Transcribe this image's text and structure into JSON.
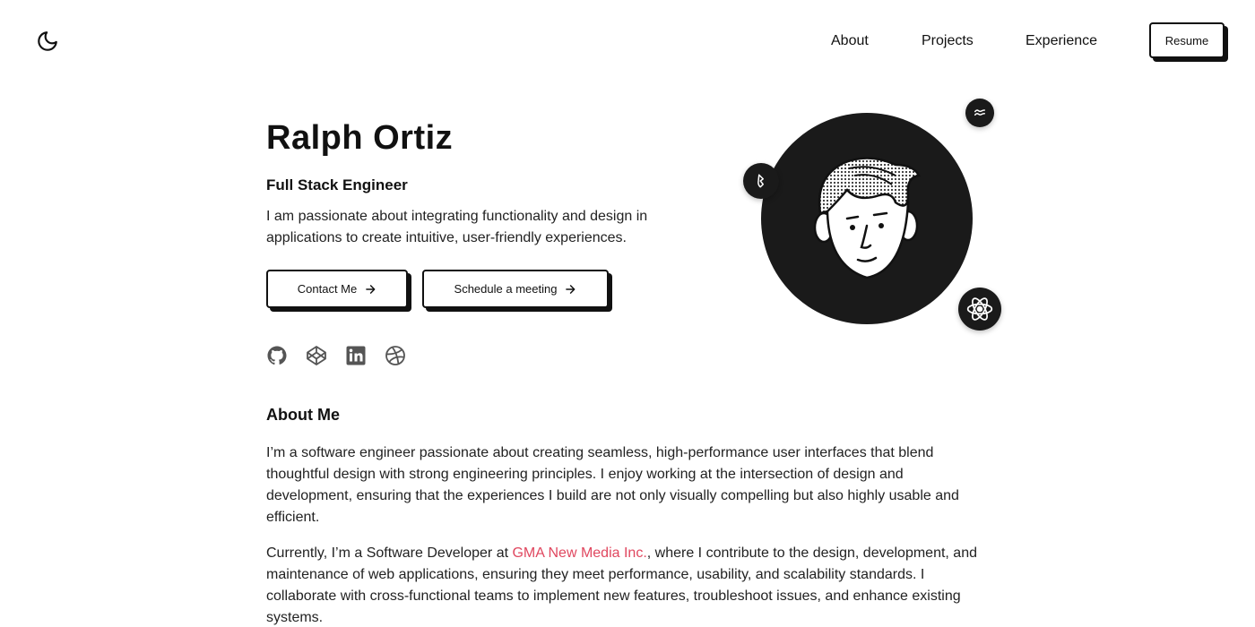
{
  "header": {
    "theme_icon": "moon-icon",
    "nav": {
      "about": "About",
      "projects": "Projects",
      "experience": "Experience"
    },
    "resume_label": "Resume"
  },
  "hero": {
    "name": "Ralph Ortiz",
    "role": "Full Stack Engineer",
    "description": "I am passionate about integrating functionality and design in applications to create intuitive, user-friendly experiences.",
    "buttons": {
      "contact": "Contact Me",
      "schedule": "Schedule a meeting"
    },
    "socials": [
      "github-icon",
      "codepen-icon",
      "linkedin-icon",
      "dribbble-icon"
    ],
    "badges": [
      "tailwind-icon",
      "figma-like-icon",
      "react-icon"
    ]
  },
  "about": {
    "title": "About Me",
    "p1": "I’m a software engineer passionate about creating seamless, high-performance user interfaces that blend thoughtful design with strong engineering principles. I enjoy working at the intersection of design and development, ensuring that the experiences I build are not only visually compelling but also highly usable and efficient.",
    "p2_before": "Currently, I’m a Software Developer at ",
    "p2_company": "GMA New Media Inc.",
    "p2_after": ", where I contribute to the design, development, and maintenance of web applications, ensuring they meet performance, usability, and scalability standards. I collaborate with cross-functional teams to implement new features, troubleshoot issues, and enhance existing systems."
  },
  "colors": {
    "accent": "#e0475f",
    "dark": "#1a1a1a",
    "background": "#ffffff"
  }
}
